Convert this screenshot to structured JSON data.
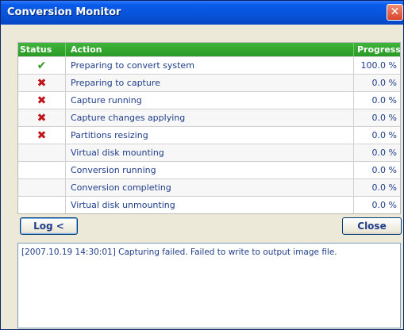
{
  "window": {
    "title": "Conversion Monitor",
    "close_glyph": "✕"
  },
  "table": {
    "headers": {
      "status": "Status",
      "action": "Action",
      "progress": "Progress"
    },
    "rows": [
      {
        "status_icon": "check-icon",
        "status_glyph": "✔",
        "action": "Preparing to convert system",
        "progress": "100.0 %"
      },
      {
        "status_icon": "error-x-icon",
        "status_glyph": "✖",
        "action": "Preparing to capture",
        "progress": "0.0 %"
      },
      {
        "status_icon": "error-x-icon",
        "status_glyph": "✖",
        "action": "Capture running",
        "progress": "0.0 %"
      },
      {
        "status_icon": "error-x-icon",
        "status_glyph": "✖",
        "action": "Capture changes applying",
        "progress": "0.0 %"
      },
      {
        "status_icon": "error-x-icon",
        "status_glyph": "✖",
        "action": "Partitions resizing",
        "progress": "0.0 %"
      },
      {
        "status_icon": "",
        "status_glyph": "",
        "action": "Virtual disk mounting",
        "progress": "0.0 %"
      },
      {
        "status_icon": "",
        "status_glyph": "",
        "action": "Conversion running",
        "progress": "0.0 %"
      },
      {
        "status_icon": "",
        "status_glyph": "",
        "action": "Conversion completing",
        "progress": "0.0 %"
      },
      {
        "status_icon": "",
        "status_glyph": "",
        "action": "Virtual disk unmounting",
        "progress": "0.0 %"
      }
    ]
  },
  "buttons": {
    "log": "Log <",
    "close": "Close"
  },
  "log": {
    "text": "[2007.10.19 14:30:01] Capturing failed. Failed to write to output image file."
  },
  "colors": {
    "success": "#2e9a1e",
    "error": "#c0141b",
    "header": "#2a9a26"
  }
}
